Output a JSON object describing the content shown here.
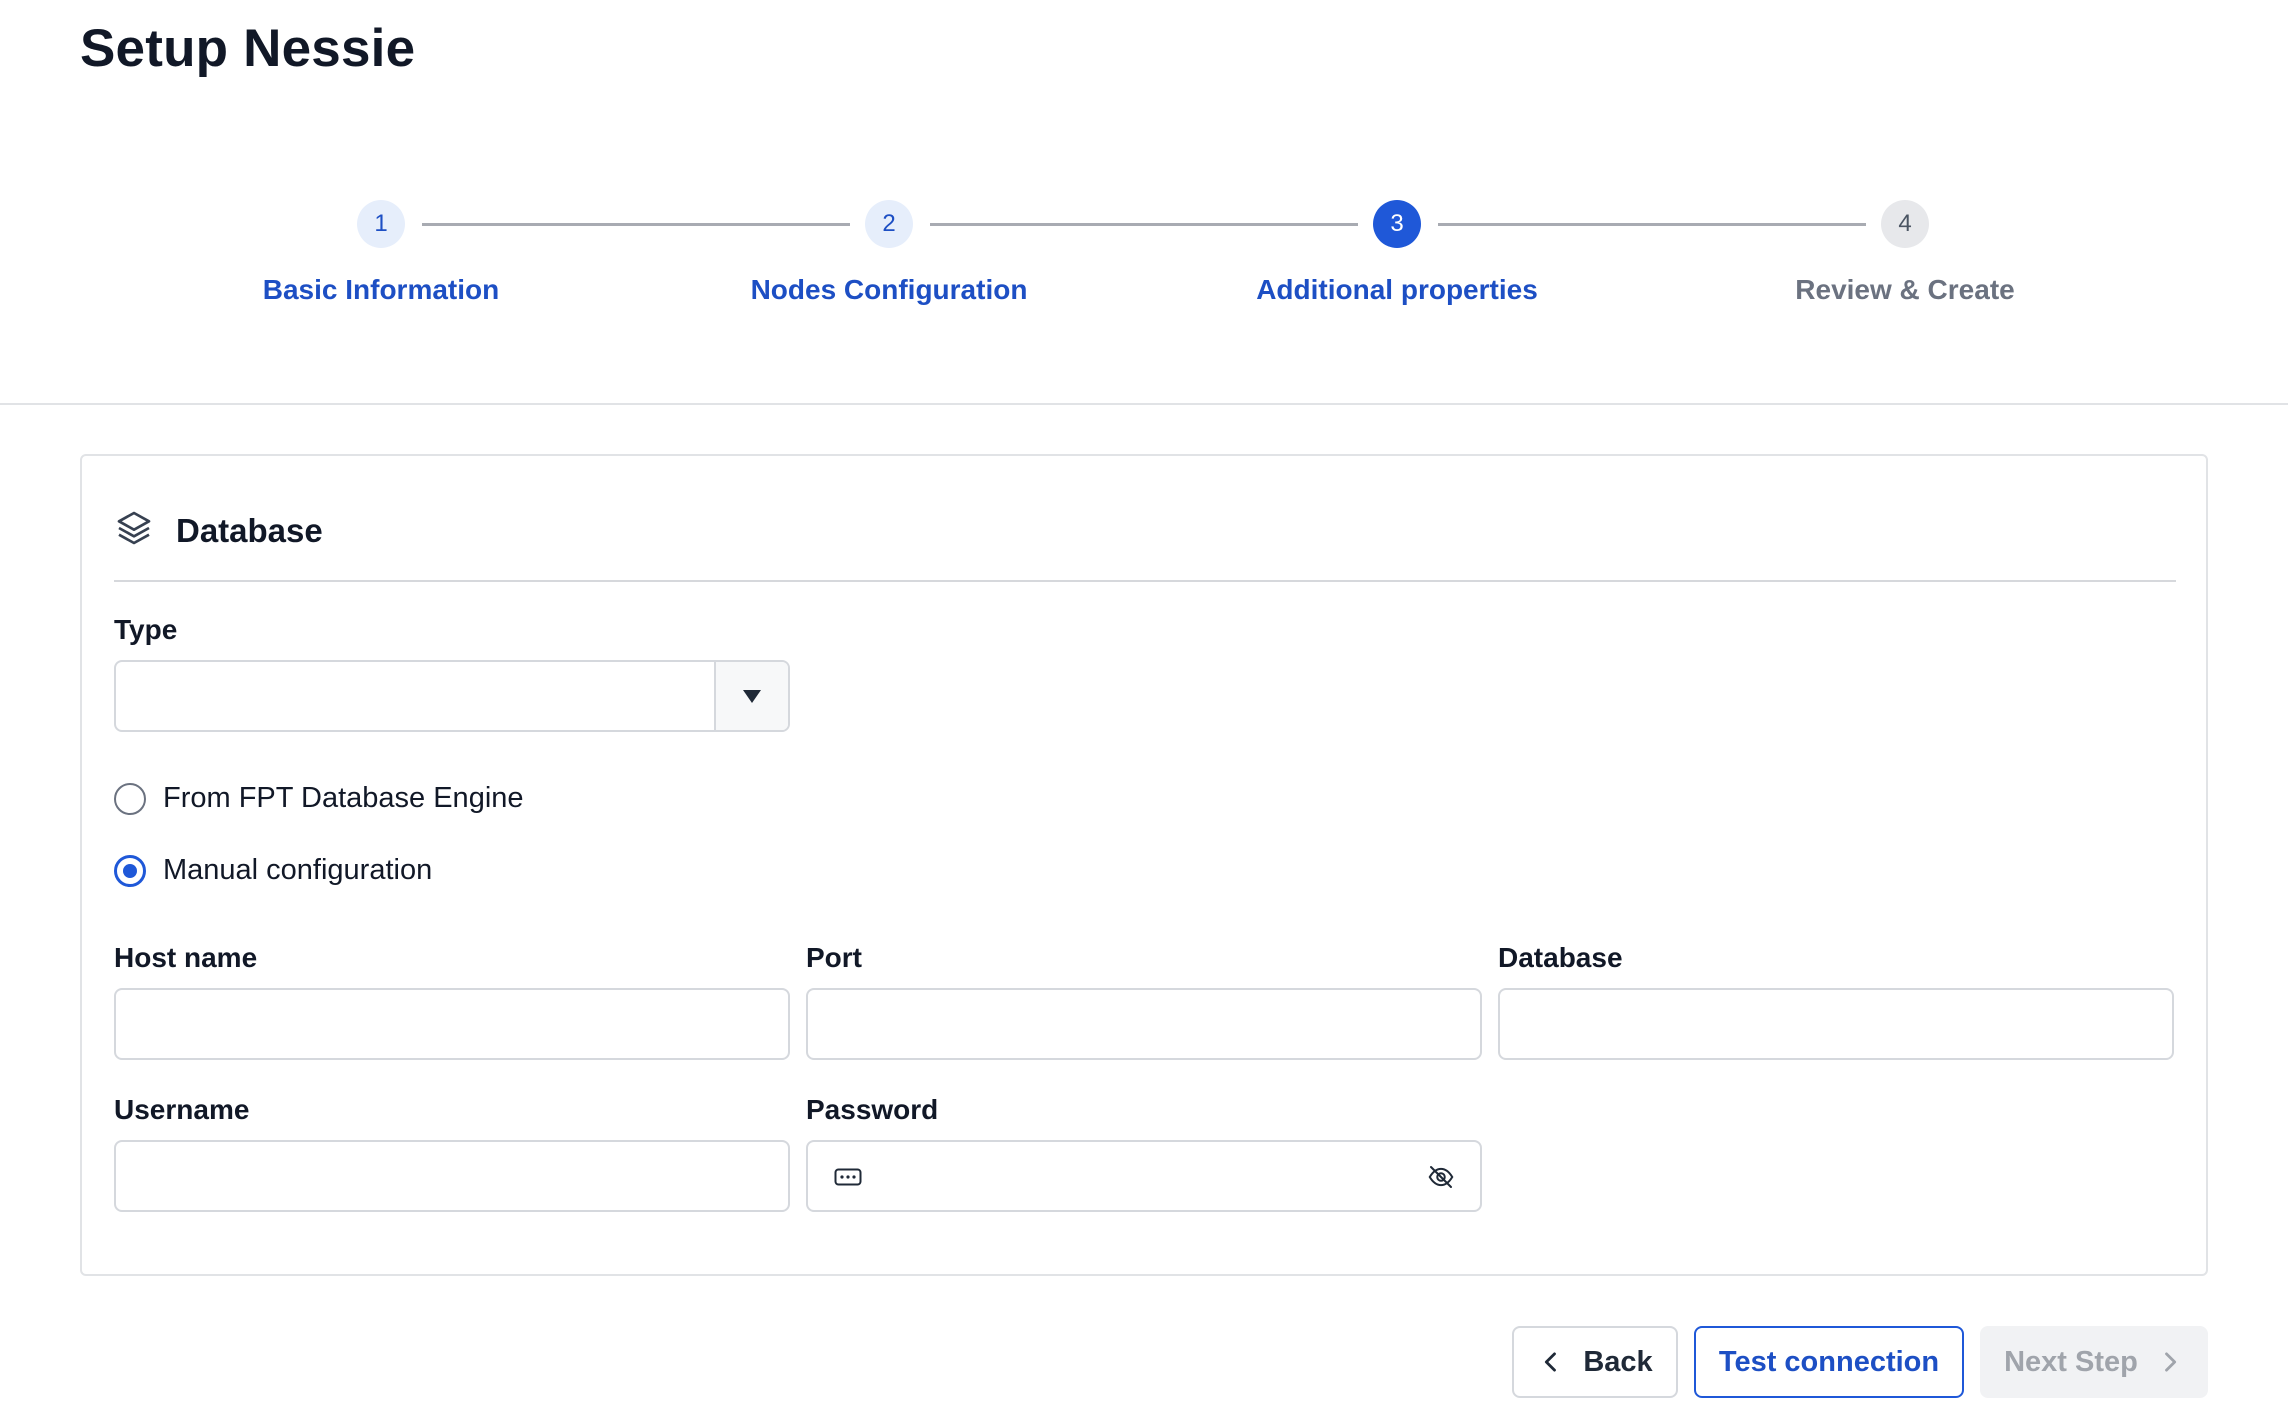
{
  "page": {
    "title": "Setup Nessie"
  },
  "stepper": {
    "steps": [
      {
        "number": "1",
        "label": "Basic Information",
        "state": "completed"
      },
      {
        "number": "2",
        "label": "Nodes Configuration",
        "state": "completed"
      },
      {
        "number": "3",
        "label": "Additional properties",
        "state": "active"
      },
      {
        "number": "4",
        "label": "Review & Create",
        "state": "pending"
      }
    ]
  },
  "database_section": {
    "icon": "layers-icon",
    "title": "Database",
    "type": {
      "label": "Type",
      "value": ""
    },
    "source_options": [
      {
        "label": "From FPT Database Engine",
        "checked": false
      },
      {
        "label": "Manual configuration",
        "checked": true
      }
    ],
    "fields": {
      "host_name": {
        "label": "Host name",
        "value": ""
      },
      "port": {
        "label": "Port",
        "value": ""
      },
      "database": {
        "label": "Database",
        "value": ""
      },
      "username": {
        "label": "Username",
        "value": ""
      },
      "password": {
        "label": "Password",
        "value": "",
        "icon_left": "password-dots-icon",
        "icon_right": "eye-off-icon"
      }
    }
  },
  "actions": {
    "back_label": "Back",
    "test_label": "Test connection",
    "next_label": "Next Step",
    "next_disabled": true
  },
  "colors": {
    "primary": "#1f58d8",
    "primary_text": "#1d4fc4",
    "muted": "#6b7280",
    "border": "#d5d8dd"
  }
}
